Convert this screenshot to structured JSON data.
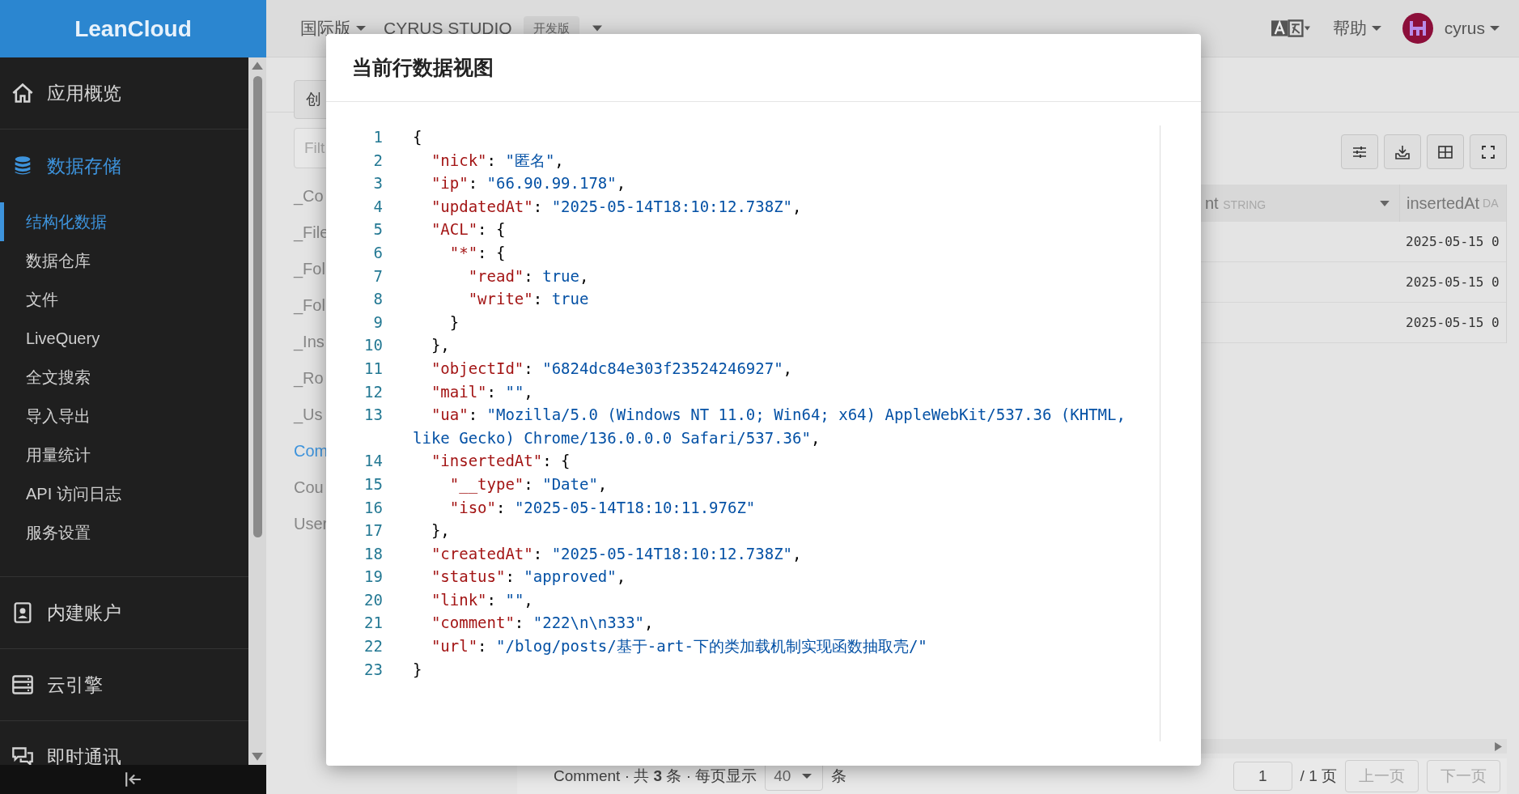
{
  "sidebar": {
    "logo": "LeanCloud",
    "sections": [
      {
        "kind": "home",
        "label": "应用概览",
        "selected": false
      },
      {
        "kind": "database",
        "label": "数据存储",
        "selected": true,
        "items": [
          {
            "label": "结构化数据",
            "selected": true
          },
          {
            "label": "数据仓库",
            "selected": false
          },
          {
            "label": "文件",
            "selected": false
          },
          {
            "label": "LiveQuery",
            "selected": false
          },
          {
            "label": "全文搜索",
            "selected": false
          },
          {
            "label": "导入导出",
            "selected": false
          },
          {
            "label": "用量统计",
            "selected": false
          },
          {
            "label": "API 访问日志",
            "selected": false
          },
          {
            "label": "服务设置",
            "selected": false
          }
        ]
      },
      {
        "kind": "account",
        "label": "内建账户",
        "selected": false
      },
      {
        "kind": "engine",
        "label": "云引擎",
        "selected": false
      },
      {
        "kind": "chat",
        "label": "即时通讯",
        "selected": false
      }
    ]
  },
  "top_bar": {
    "region": "国际版",
    "app_name": "CYRUS STUDIO",
    "app_badge": "开发版",
    "help": "帮助",
    "user": "cyrus"
  },
  "class_panel": {
    "create_button": "创",
    "filter_placeholder": "Filt",
    "classes": [
      {
        "name": "_Co",
        "selected": false
      },
      {
        "name": "_File",
        "selected": false
      },
      {
        "name": "_Fol",
        "selected": false
      },
      {
        "name": "_Fol",
        "selected": false
      },
      {
        "name": "_Ins",
        "selected": false
      },
      {
        "name": "_Ro",
        "selected": false
      },
      {
        "name": "_Us",
        "selected": false
      },
      {
        "name": "Com",
        "selected": true
      },
      {
        "name": "Cou",
        "selected": false
      },
      {
        "name": "User",
        "selected": false
      }
    ]
  },
  "table": {
    "columns": [
      {
        "name": "nt",
        "type": "STRING"
      },
      {
        "name": "insertedAt",
        "type": "DA"
      }
    ],
    "rows": [
      {
        "inserted_at": "2025-05-15 0"
      },
      {
        "inserted_at": "2025-05-15 0"
      },
      {
        "inserted_at": "2025-05-15 0"
      }
    ]
  },
  "pagination": {
    "summary": "Comment · 共 **3** 条 · 每页显示",
    "page_size": "40",
    "unit": "条",
    "page": "1",
    "page_total": "/ 1 页",
    "prev": "上一页",
    "next": "下一页"
  },
  "modal": {
    "title": "当前行数据视图",
    "lines": [
      {
        "number": "1",
        "text": "{"
      },
      {
        "number": "2",
        "text": "  \"nick\": \"匿名\","
      },
      {
        "number": "3",
        "text": "  \"ip\": \"66.90.99.178\","
      },
      {
        "number": "4",
        "text": "  \"updatedAt\": \"2025-05-14T18:10:12.738Z\","
      },
      {
        "number": "5",
        "text": "  \"ACL\": {"
      },
      {
        "number": "6",
        "text": "    \"*\": {"
      },
      {
        "number": "7",
        "text": "      \"read\": true,"
      },
      {
        "number": "8",
        "text": "      \"write\": true"
      },
      {
        "number": "9",
        "text": "    }"
      },
      {
        "number": "10",
        "text": "  },"
      },
      {
        "number": "11",
        "text": "  \"objectId\": \"6824dc84e303f23524246927\","
      },
      {
        "number": "12",
        "text": "  \"mail\": \"\","
      },
      {
        "number": "13",
        "text": "  \"ua\": \"Mozilla/5.0 (Windows NT 11.0; Win64; x64) AppleWebKit/537.36 (KHTML, like Gecko) Chrome/136.0.0.0 Safari/537.36\","
      },
      {
        "number": "14",
        "text": "  \"insertedAt\": {"
      },
      {
        "number": "15",
        "text": "    \"__type\": \"Date\","
      },
      {
        "number": "16",
        "text": "    \"iso\": \"2025-05-14T18:10:11.976Z\""
      },
      {
        "number": "17",
        "text": "  },"
      },
      {
        "number": "18",
        "text": "  \"createdAt\": \"2025-05-14T18:10:12.738Z\","
      },
      {
        "number": "19",
        "text": "  \"status\": \"approved\","
      },
      {
        "number": "20",
        "text": "  \"link\": \"\","
      },
      {
        "number": "21",
        "text": "  \"comment\": \"222\\n\\n333\","
      },
      {
        "number": "22",
        "text": "  \"url\": \"/blog/posts/基于-art-下的类加载机制实现函数抽取壳/\""
      },
      {
        "number": "23",
        "text": "}"
      }
    ]
  }
}
